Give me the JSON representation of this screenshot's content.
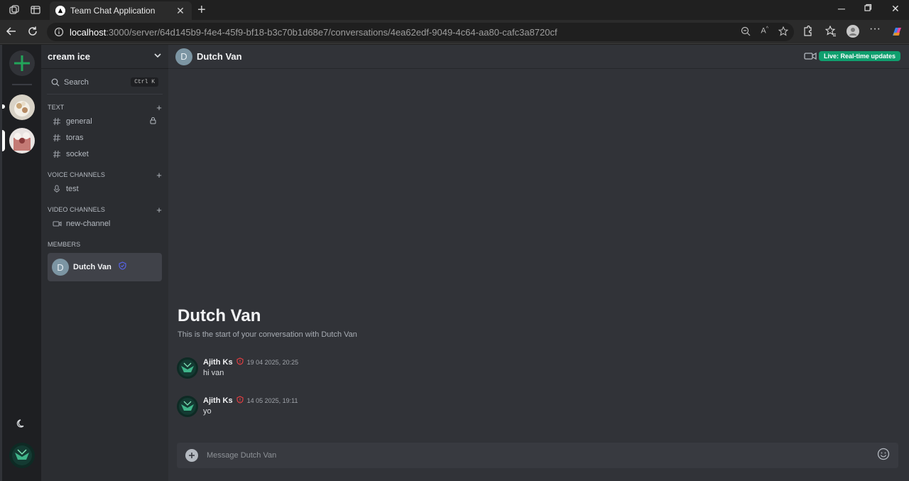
{
  "browser": {
    "tab_title": "Team Chat Application",
    "url_host": "localhost",
    "url_rest": ":3000/server/64d145b9-f4e4-45f9-bf18-b3c70b1d68e7/conversations/4ea62edf-9049-4c64-aa80-cafc3a8720cf"
  },
  "sidebar": {
    "server_name": "cream ice",
    "search_label": "Search",
    "search_shortcut": "Ctrl K",
    "sections": {
      "text": "TEXT",
      "voice": "VOICE CHANNELS",
      "video": "VIDEO CHANNELS",
      "members": "MEMBERS"
    },
    "text_channels": [
      "general",
      "toras",
      "socket"
    ],
    "voice_channels": [
      "test"
    ],
    "video_channels": [
      "new-channel"
    ],
    "members": [
      {
        "initial": "D",
        "name": "Dutch Van"
      }
    ]
  },
  "chat": {
    "header_initial": "D",
    "header_name": "Dutch Van",
    "live_badge": "Live: Real-time updates",
    "welcome_title": "Dutch Van",
    "welcome_subtitle": "This is the start of your conversation with Dutch Van",
    "messages": [
      {
        "author": "Ajith Ks",
        "time": "19 04 2025, 20:25",
        "text": "hi van"
      },
      {
        "author": "Ajith Ks",
        "time": "14 05 2025, 19:11",
        "text": "yo"
      }
    ],
    "composer_placeholder": "Message Dutch Van"
  },
  "colors": {
    "accent_green": "#23a55a",
    "live_badge": "#0f9f6e",
    "admin_shield": "#f23f43",
    "moderator_shield": "#5865f2"
  }
}
